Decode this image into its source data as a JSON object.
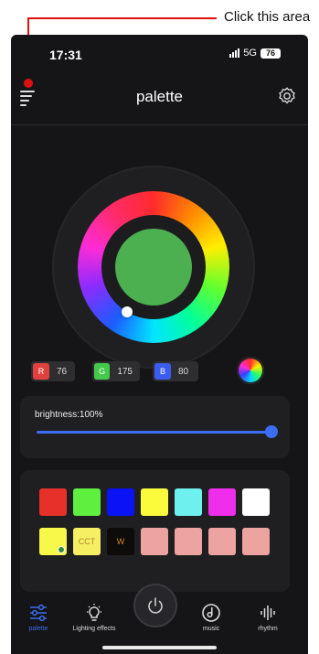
{
  "annotation": {
    "text": "Click this area",
    "color": "#dd1111"
  },
  "status_bar": {
    "time": "17:31",
    "network": "5G",
    "battery": "76"
  },
  "header": {
    "title": "palette",
    "menu_icon": "menu-icon",
    "settings_icon": "gear-icon"
  },
  "color_wheel": {
    "selected_color": "#4caf50"
  },
  "rgb": {
    "r": {
      "tag": "R",
      "value": "76",
      "color": "#e0413f"
    },
    "g": {
      "tag": "G",
      "value": "175",
      "color": "#45c94b"
    },
    "b": {
      "tag": "B",
      "value": "80",
      "color": "#3c5cf0"
    }
  },
  "brightness": {
    "label": "brightness:100%",
    "level": 1.0
  },
  "swatches": {
    "row1": [
      "#e8302b",
      "#5fef3f",
      "#0a13f5",
      "#fbfb3c",
      "#6ef0ef",
      "#ee2eea",
      "#ffffff"
    ],
    "row2": [
      {
        "color": "#f8f84a",
        "label": "",
        "selected": true
      },
      {
        "color": "#f6ef64",
        "label": "CCT",
        "selected": false
      },
      {
        "color": "#0e0c0a",
        "label": "W",
        "selected": false
      },
      {
        "color": "#eda3a0",
        "label": "",
        "selected": false
      },
      {
        "color": "#eda3a0",
        "label": "",
        "selected": false
      },
      {
        "color": "#eda3a0",
        "label": "",
        "selected": false
      },
      {
        "color": "#eda3a0",
        "label": "",
        "selected": false
      }
    ]
  },
  "tabs": {
    "palette": "palette",
    "lighting": "Lighting effects",
    "music": "music",
    "rhythm": "rhythm"
  },
  "accent_color": "#3c6cf0"
}
